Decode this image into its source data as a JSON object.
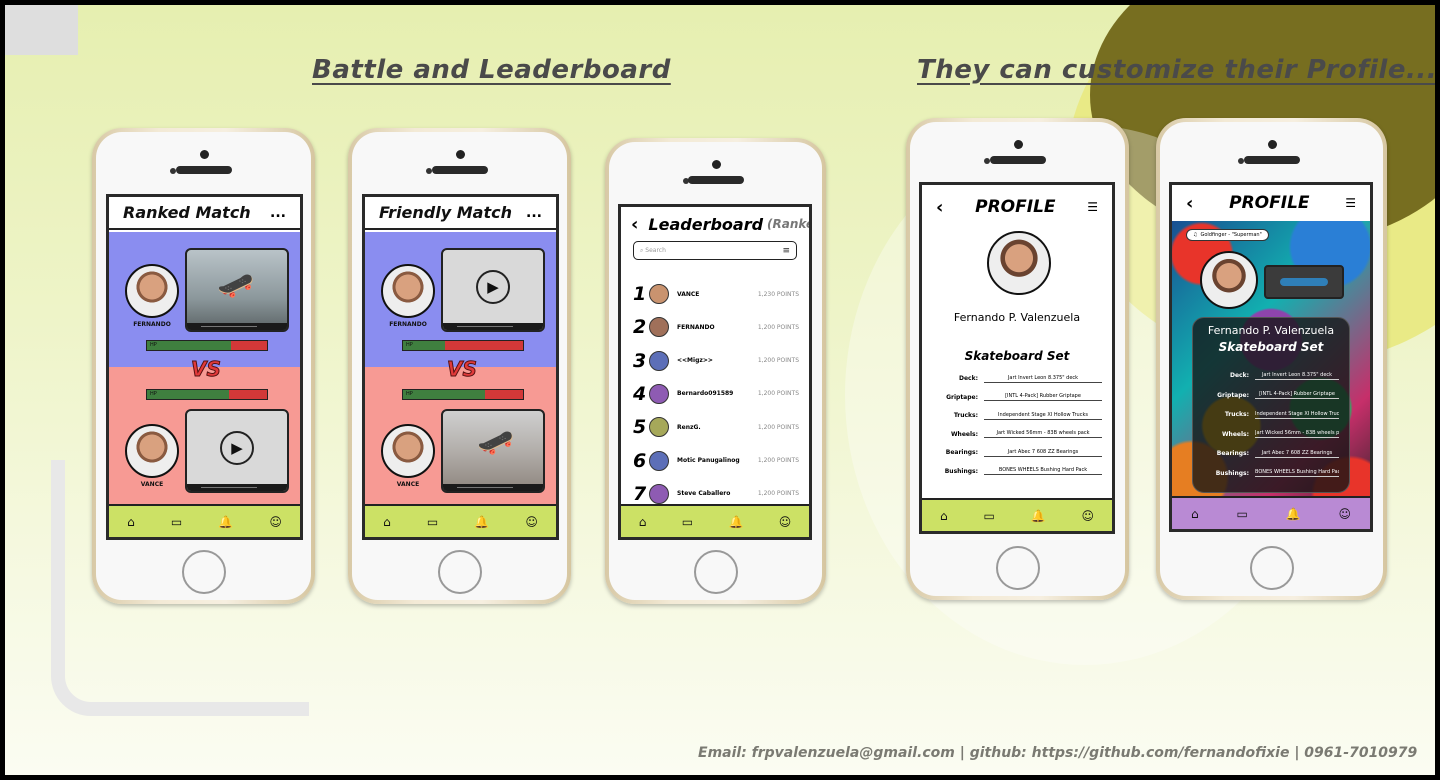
{
  "headings": {
    "battle": "Battle and Leaderboard",
    "profile": "They can customize their Profile..."
  },
  "footer": "Email: frpvalenzuela@gmail.com | github: https://github.com/fernandofixie | 0961-7010979",
  "ranked": {
    "title": "Ranked Match",
    "menu": "...",
    "player1": "FERNANDO",
    "player2": "VANCE",
    "hp_label": "HP",
    "vs": "VS",
    "hp1": 0.7,
    "hp2": 0.68
  },
  "friendly": {
    "title": "Friendly Match",
    "menu": "...",
    "player1": "FERNANDO",
    "player2": "VANCE",
    "hp_label": "HP",
    "vs": "VS",
    "hp1": 0.35,
    "hp2": 0.68
  },
  "leaderboard": {
    "title": "Leaderboard",
    "subtitle": "(Ranked)",
    "search_placeholder": "Search",
    "rows": [
      {
        "rank": "1",
        "name": "VANCE",
        "points": "1,230 POINTS"
      },
      {
        "rank": "2",
        "name": "FERNANDO",
        "points": "1,200 POINTS"
      },
      {
        "rank": "3",
        "name": "<<Migz>>",
        "points": "1,200 POINTS"
      },
      {
        "rank": "4",
        "name": "Bernardo091589",
        "points": "1,200 POINTS"
      },
      {
        "rank": "5",
        "name": "RenzG.",
        "points": "1,200 POINTS"
      },
      {
        "rank": "6",
        "name": "Motic Panugalinog",
        "points": "1,200 POINTS"
      },
      {
        "rank": "7",
        "name": "Steve Caballero",
        "points": "1,200 POINTS"
      }
    ]
  },
  "profile": {
    "title": "PROFILE",
    "name": "Fernando P. Valenzuela",
    "set_title": "Skateboard Set",
    "song": "Goldfinger - \"Superman\"",
    "specs": [
      {
        "label": "Deck:",
        "value": "Jart Invert Leon 8.375\" deck"
      },
      {
        "label": "Griptape:",
        "value": "[INTL 4-Pack] Rubber Griptape"
      },
      {
        "label": "Trucks:",
        "value": "Independent Stage XI Hollow Trucks"
      },
      {
        "label": "Wheels:",
        "value": "Jart Wicked 56mm - 83B wheels pack"
      },
      {
        "label": "Bearings:",
        "value": "Jart Abec 7 608 ZZ Bearings"
      },
      {
        "label": "Bushings:",
        "value": "BONES WHEELS Bushing Hard Pack"
      }
    ]
  },
  "nav_icons": [
    "home-icon",
    "chat-icon",
    "bell-icon",
    "user-icon"
  ],
  "colors": {
    "nav_lime": "#cce165",
    "nav_lilac": "#b98ad4",
    "panel_blue": "#8a8df0",
    "panel_red": "#f79a94",
    "hp_green": "#3f7f3f",
    "hp_red": "#d23838"
  }
}
